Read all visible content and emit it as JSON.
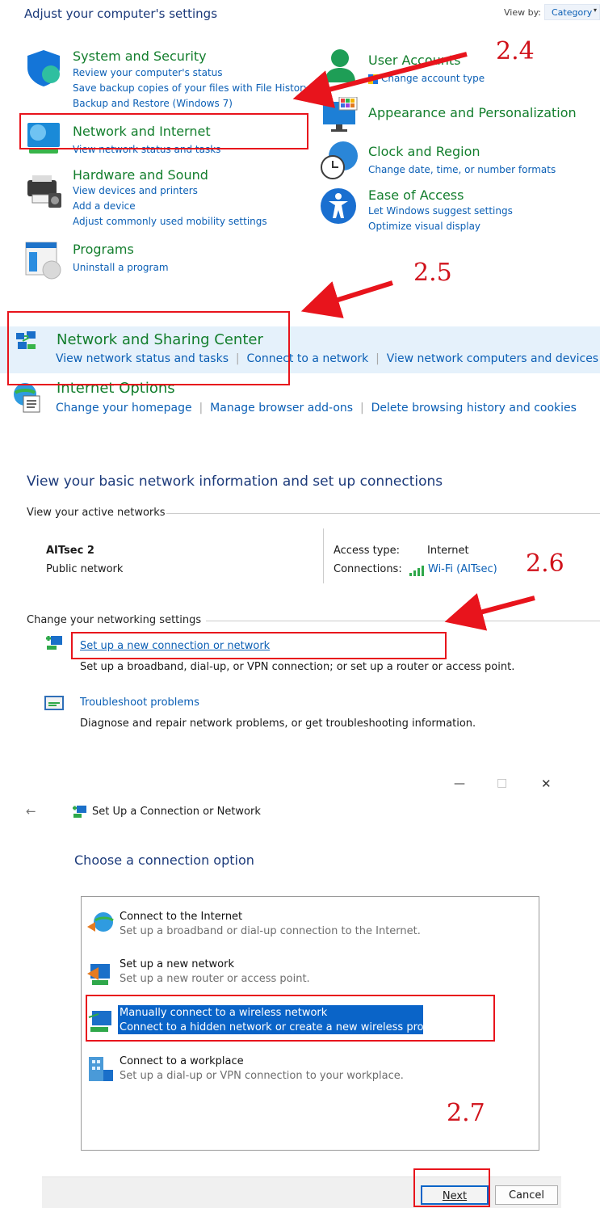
{
  "control_panel": {
    "title": "Adjust your computer's settings",
    "view_by_label": "View by:",
    "view_by_value": "Category",
    "categories": [
      {
        "title": "System and Security",
        "links": [
          "Review your computer's status",
          "Save backup copies of your files with File History",
          "Backup and Restore (Windows 7)"
        ]
      },
      {
        "title": "Network and Internet",
        "links": [
          "View network status and tasks"
        ]
      },
      {
        "title": "Hardware and Sound",
        "links": [
          "View devices and printers",
          "Add a device",
          "Adjust commonly used mobility settings"
        ]
      },
      {
        "title": "Programs",
        "links": [
          "Uninstall a program"
        ]
      },
      {
        "title": "User Accounts",
        "links": [
          "Change account type"
        ]
      },
      {
        "title": "Appearance and Personalization",
        "links": []
      },
      {
        "title": "Clock and Region",
        "links": [
          "Change date, time, or number formats"
        ]
      },
      {
        "title": "Ease of Access",
        "links": [
          "Let Windows suggest settings",
          "Optimize visual display"
        ]
      }
    ]
  },
  "network_internet": {
    "items": [
      {
        "title": "Network and Sharing Center",
        "links": [
          "View network status and tasks",
          "Connect to a network",
          "View network computers and devices"
        ]
      },
      {
        "title": "Internet Options",
        "links": [
          "Change your homepage",
          "Manage browser add-ons",
          "Delete browsing history and cookies"
        ]
      }
    ]
  },
  "sharing_center": {
    "title": "View your basic network information and set up connections",
    "active_networks_label": "View your active networks",
    "network_name": "AITsec 2",
    "network_type": "Public network",
    "access_type_label": "Access type:",
    "access_type_value": "Internet",
    "connections_label": "Connections:",
    "connections_value": "Wi-Fi (AITsec)",
    "change_settings_label": "Change your networking settings",
    "actions": [
      {
        "title": "Set up a new connection or network",
        "desc": "Set up a broadband, dial-up, or VPN connection; or set up a router or access point."
      },
      {
        "title": "Troubleshoot problems",
        "desc": "Diagnose and repair network problems, or get troubleshooting information."
      }
    ]
  },
  "wizard": {
    "window_controls": {
      "minimize": "—",
      "maximize": "□",
      "close": "✕"
    },
    "back": "←",
    "title": "Set Up a Connection or Network",
    "heading": "Choose a connection option",
    "options": [
      {
        "title": "Connect to the Internet",
        "desc": "Set up a broadband or dial-up connection to the Internet."
      },
      {
        "title": "Set up a new network",
        "desc": "Set up a new router or access point."
      },
      {
        "title": "Manually connect to a wireless network",
        "desc": "Connect to a hidden network or create a new wireless profile."
      },
      {
        "title": "Connect to a workplace",
        "desc": "Set up a dial-up or VPN connection to your workplace."
      }
    ],
    "next_label": "Next",
    "cancel_label": "Cancel"
  },
  "annotations": [
    "2.4",
    "2.5",
    "2.6",
    "2.7"
  ],
  "colors": {
    "link": "#0b5fb5",
    "category_title": "#137e2d",
    "annotation": "#e8141c",
    "selection": "#0a64c8",
    "highlight_row": "#e5f1fb"
  }
}
